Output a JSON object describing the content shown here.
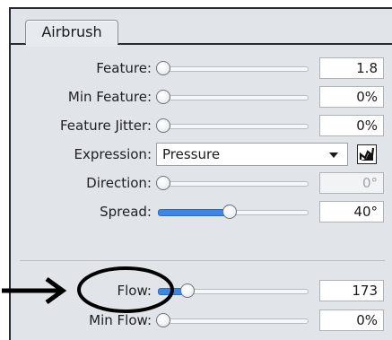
{
  "tab": {
    "label": "Airbrush"
  },
  "rows": {
    "feature": {
      "label": "Feature:",
      "value": "1.8",
      "level": 0.0
    },
    "min_feature": {
      "label": "Min Feature:",
      "value": "0%",
      "level": 0.0
    },
    "feature_jitter": {
      "label": "Feature Jitter:",
      "value": "0%",
      "level": 0.0
    },
    "expression": {
      "label": "Expression:",
      "selected": "Pressure",
      "icon": "pressure-toggle-icon"
    },
    "direction": {
      "label": "Direction:",
      "value": "0°",
      "level": 0.0
    },
    "spread": {
      "label": "Spread:",
      "value": "40°",
      "level": 0.47
    },
    "flow": {
      "label": "Flow:",
      "value": "173",
      "level": 0.17
    },
    "min_flow": {
      "label": "Min Flow:",
      "value": "0%",
      "level": 0.0
    }
  },
  "colors": {
    "accent": "#3f86e0",
    "annotation": "#000000"
  }
}
